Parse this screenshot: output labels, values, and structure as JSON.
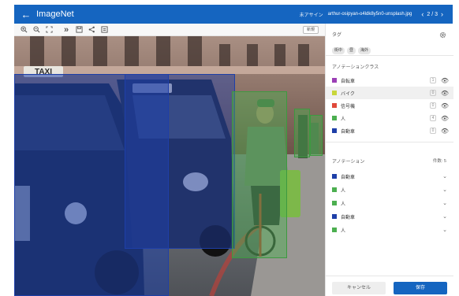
{
  "header": {
    "app_title": "ImageNet",
    "status": "未アサイン",
    "filename": "arthur-osipyan-o4ldk8y5n0-unsplash.jpg",
    "page": "2 / 3"
  },
  "toolbar": {
    "icons": [
      "zoom-in-icon",
      "zoom-out-icon",
      "fit-screen-icon",
      "skip-forward-icon",
      "save-icon",
      "share-icon",
      "notes-icon"
    ],
    "new_label": "新規"
  },
  "panel": {
    "tags_title": "タグ",
    "tags": [
      "街中",
      "昼",
      "海外"
    ],
    "classes_title": "アノテーションクラス",
    "classes": [
      {
        "label": "自転車",
        "color": "#9b3fb5",
        "count": "1"
      },
      {
        "label": "バイク",
        "color": "#c8d63a",
        "count": "0"
      },
      {
        "label": "信号機",
        "color": "#e0493a",
        "count": "0"
      },
      {
        "label": "人",
        "color": "#4caf50",
        "count": "4"
      },
      {
        "label": "自動車",
        "color": "#1e3fa8",
        "count": "0"
      }
    ],
    "annotations_title": "アノテーション",
    "annotations_count": "件数: 5",
    "annotations": [
      {
        "label": "自動車",
        "color": "#1e3fa8"
      },
      {
        "label": "人",
        "color": "#4caf50"
      },
      {
        "label": "人",
        "color": "#4caf50"
      },
      {
        "label": "自動車",
        "color": "#1e3fa8"
      },
      {
        "label": "人",
        "color": "#4caf50"
      }
    ],
    "cancel_label": "キャンセル",
    "save_label": "保存"
  },
  "colors": {
    "accent": "#1565c0",
    "car_overlay": "#1e3fa8",
    "person_overlay": "#4caf50"
  }
}
